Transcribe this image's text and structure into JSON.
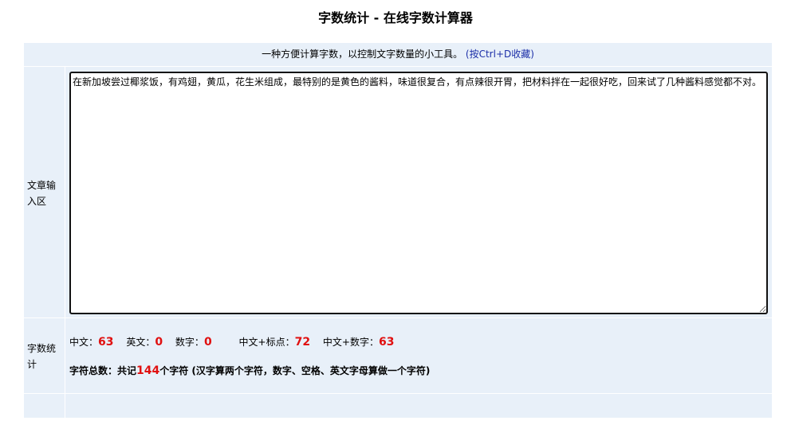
{
  "page": {
    "title": "字数统计 - 在线字数计算器"
  },
  "intro": {
    "text": "一种方便计算字数，以控制文字数量的小工具。",
    "hint": "(按Ctrl+D收藏)"
  },
  "input_section": {
    "label": "文章输入区",
    "value": "在新加坡尝过椰浆饭，有鸡翅，黄瓜，花生米组成，最特别的是黄色的酱料，味道很复合，有点辣很开胃，把材料拌在一起很好吃，回来试了几种酱料感觉都不对。"
  },
  "stats_section": {
    "label": "字数统计",
    "chinese_label": "中文：",
    "chinese_count": "63",
    "english_label": "英文：",
    "english_count": "0",
    "digit_label": "数字：",
    "digit_count": "0",
    "cn_punct_label": "中文+标点：",
    "cn_punct_count": "72",
    "cn_digit_label": "中文+数字：",
    "cn_digit_count": "63",
    "total_prefix": "字符总数：共记",
    "total_count": "144",
    "total_suffix": "个字符 (汉字算两个字符，数字、空格、英文字母算做一个字符)"
  },
  "colors": {
    "panel_bg": "#e8f0f9",
    "count_red": "#e01010",
    "hint_blue": "#1c2fa8"
  }
}
